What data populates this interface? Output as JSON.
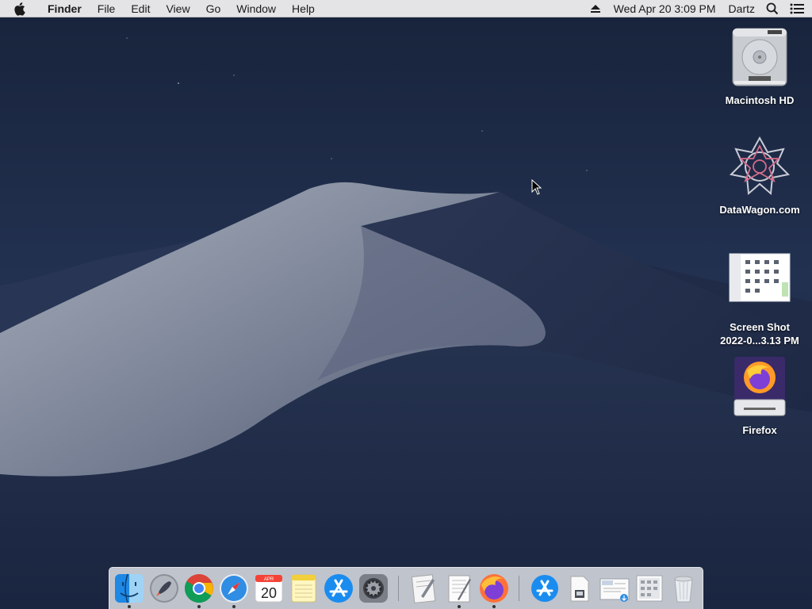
{
  "menubar": {
    "app_name": "Finder",
    "menus": [
      "File",
      "Edit",
      "View",
      "Go",
      "Window",
      "Help"
    ],
    "clock": "Wed Apr 20  3:09 PM",
    "user": "Dartz"
  },
  "desktop": {
    "icons": [
      {
        "label": "Macintosh HD",
        "icon": "hard-drive-icon"
      },
      {
        "label": "DataWagon.com",
        "icon": "datawagon-icon"
      },
      {
        "label_line1": "Screen Shot",
        "label_line2": "2022-0...3.13 PM",
        "icon": "screenshot-thumbnail-icon"
      },
      {
        "label": "Firefox",
        "icon": "firefox-disk-image-icon"
      }
    ]
  },
  "dock": {
    "apps": [
      {
        "name": "Finder",
        "icon": "finder-icon",
        "running": true
      },
      {
        "name": "Launchpad",
        "icon": "launchpad-icon",
        "running": false
      },
      {
        "name": "Google Chrome",
        "icon": "chrome-icon",
        "running": true
      },
      {
        "name": "Safari",
        "icon": "safari-icon",
        "running": true
      },
      {
        "name": "Calendar",
        "icon": "calendar-icon",
        "running": false,
        "month": "APR",
        "day": "20"
      },
      {
        "name": "Notes",
        "icon": "notes-icon",
        "running": false
      },
      {
        "name": "App Store",
        "icon": "app-store-icon",
        "running": false
      },
      {
        "name": "System Preferences",
        "icon": "system-preferences-icon",
        "running": false
      },
      {
        "name": "Script Editor",
        "icon": "script-editor-icon",
        "running": false
      },
      {
        "name": "TextEdit",
        "icon": "textedit-icon",
        "running": true
      },
      {
        "name": "Firefox",
        "icon": "firefox-icon",
        "running": true
      },
      {
        "name": "Applications",
        "icon": "applications-folder-icon",
        "running": false
      },
      {
        "name": "Documents",
        "icon": "document-stack-icon",
        "running": false
      },
      {
        "name": "Downloads",
        "icon": "downloads-stack-icon",
        "running": false
      },
      {
        "name": "Screenshots",
        "icon": "screenshot-stack-icon",
        "running": false
      },
      {
        "name": "Trash",
        "icon": "trash-icon",
        "running": false
      }
    ]
  },
  "colors": {
    "sky_top": "#1b2740",
    "sky_bottom": "#2b3a58",
    "dune_light": "#9aa3b4",
    "dune_shadow": "#1d2944",
    "menubar_bg": "#ececee"
  }
}
